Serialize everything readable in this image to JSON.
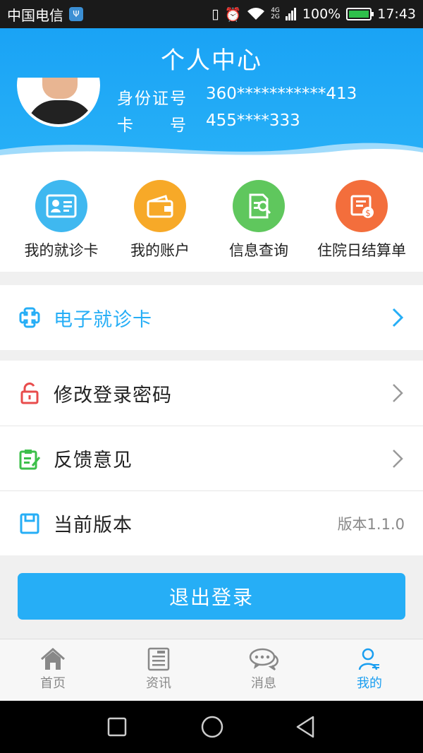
{
  "status_bar": {
    "carrier": "中国电信",
    "battery": "100%",
    "time": "17:43",
    "net_top": "4G",
    "net_bottom": "2G"
  },
  "header": {
    "title": "个人中心",
    "id_label": "身份证号",
    "id_value": "360***********413",
    "card_label": "卡　　号",
    "card_value": "455****333"
  },
  "quick_actions": [
    {
      "label": "我的就诊卡",
      "icon": "id-card-icon",
      "color": "#3fb8f0"
    },
    {
      "label": "我的账户",
      "icon": "wallet-icon",
      "color": "#f7a928"
    },
    {
      "label": "信息查询",
      "icon": "document-search-icon",
      "color": "#5fc75d"
    },
    {
      "label": "住院日结算单",
      "icon": "bill-icon",
      "color": "#f36e3c"
    }
  ],
  "menu": {
    "ecard": "电子就诊卡",
    "change_password": "修改登录密码",
    "feedback": "反馈意见",
    "version_label": "当前版本",
    "version_value": "版本1.1.0"
  },
  "logout_label": "退出登录",
  "tabs": [
    {
      "label": "首页",
      "icon": "home-icon"
    },
    {
      "label": "资讯",
      "icon": "news-icon"
    },
    {
      "label": "消息",
      "icon": "chat-icon"
    },
    {
      "label": "我的",
      "icon": "user-icon",
      "active": true
    }
  ],
  "colors": {
    "primary": "#26aef6",
    "header": "#1aa3f5"
  }
}
